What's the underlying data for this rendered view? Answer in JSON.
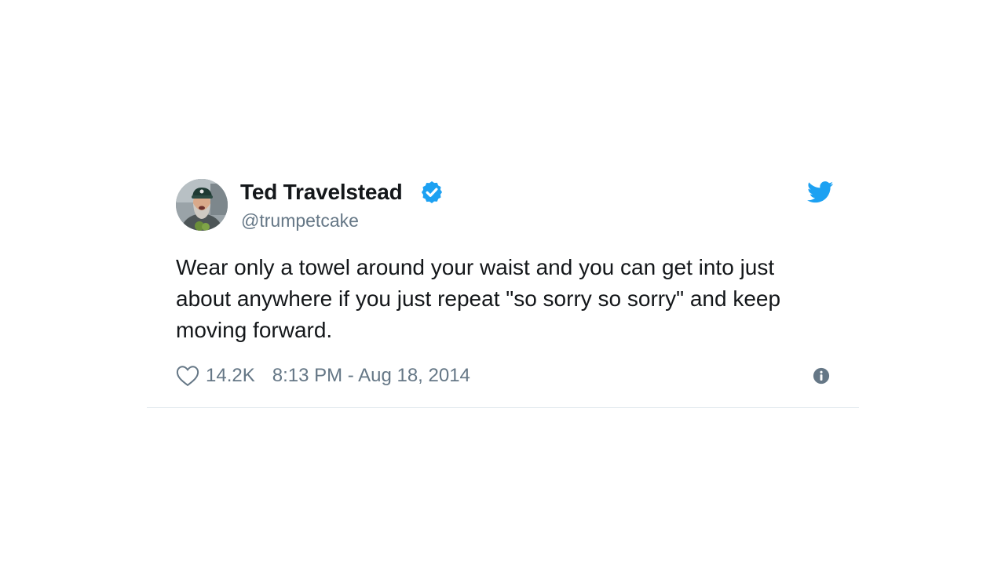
{
  "tweet": {
    "author": {
      "name": "Ted Travelstead",
      "handle": "@trumpetcake",
      "verified": true,
      "avatar_icon": "bearded-man-avatar"
    },
    "text": "Wear only a towel around your waist and you can get into just about anywhere if you just repeat \"so sorry so sorry\" and keep moving forward.",
    "likes": "14.2K",
    "timestamp": "8:13 PM - Aug 18, 2014",
    "icons": {
      "brand": "twitter-bird-icon",
      "like": "heart-icon",
      "info": "info-icon",
      "verified": "verified-badge-icon"
    },
    "colors": {
      "brand": "#1da1f2",
      "text": "#14171a",
      "secondary": "#657786",
      "divider": "#e1e8ed"
    }
  }
}
